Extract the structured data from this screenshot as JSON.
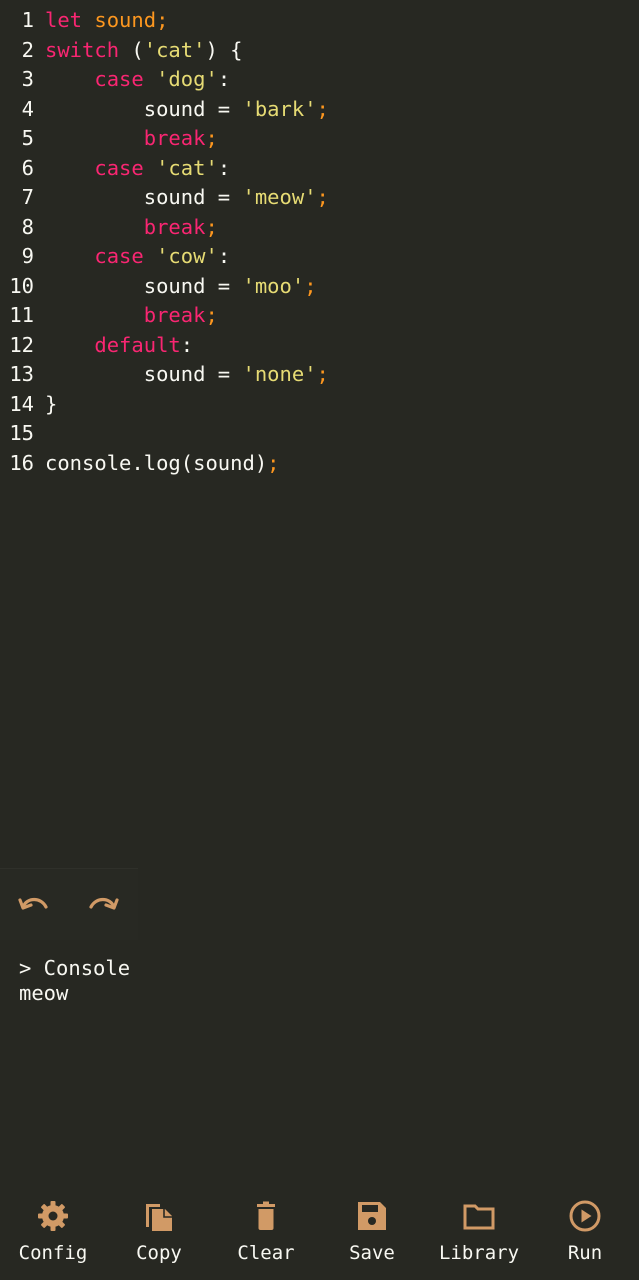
{
  "colors": {
    "background": "#272822",
    "keyword": "#f92672",
    "variable": "#fd971f",
    "string": "#e6db74",
    "text": "#f8f8f2",
    "icon": "#d19a66"
  },
  "editor": {
    "lines": [
      {
        "n": "1",
        "tokens": [
          {
            "t": "let",
            "c": "kw"
          },
          {
            "t": " sound",
            "c": "var"
          },
          {
            "t": ";",
            "c": "punc"
          }
        ]
      },
      {
        "n": "2",
        "tokens": [
          {
            "t": "switch",
            "c": "kw"
          },
          {
            "t": " (",
            "c": "plain"
          },
          {
            "t": "'cat'",
            "c": "str"
          },
          {
            "t": ") {",
            "c": "plain"
          }
        ]
      },
      {
        "n": "3",
        "tokens": [
          {
            "t": "    ",
            "c": "plain"
          },
          {
            "t": "case",
            "c": "kw"
          },
          {
            "t": " ",
            "c": "plain"
          },
          {
            "t": "'dog'",
            "c": "str"
          },
          {
            "t": ":",
            "c": "plain"
          }
        ]
      },
      {
        "n": "4",
        "tokens": [
          {
            "t": "        sound = ",
            "c": "plain"
          },
          {
            "t": "'bark'",
            "c": "str"
          },
          {
            "t": ";",
            "c": "punc"
          }
        ]
      },
      {
        "n": "5",
        "tokens": [
          {
            "t": "        ",
            "c": "plain"
          },
          {
            "t": "break",
            "c": "kw"
          },
          {
            "t": ";",
            "c": "punc"
          }
        ]
      },
      {
        "n": "6",
        "tokens": [
          {
            "t": "    ",
            "c": "plain"
          },
          {
            "t": "case",
            "c": "kw"
          },
          {
            "t": " ",
            "c": "plain"
          },
          {
            "t": "'cat'",
            "c": "str"
          },
          {
            "t": ":",
            "c": "plain"
          }
        ]
      },
      {
        "n": "7",
        "tokens": [
          {
            "t": "        sound = ",
            "c": "plain"
          },
          {
            "t": "'meow'",
            "c": "str"
          },
          {
            "t": ";",
            "c": "punc"
          }
        ]
      },
      {
        "n": "8",
        "tokens": [
          {
            "t": "        ",
            "c": "plain"
          },
          {
            "t": "break",
            "c": "kw"
          },
          {
            "t": ";",
            "c": "punc"
          }
        ]
      },
      {
        "n": "9",
        "tokens": [
          {
            "t": "    ",
            "c": "plain"
          },
          {
            "t": "case",
            "c": "kw"
          },
          {
            "t": " ",
            "c": "plain"
          },
          {
            "t": "'cow'",
            "c": "str"
          },
          {
            "t": ":",
            "c": "plain"
          }
        ]
      },
      {
        "n": "10",
        "tokens": [
          {
            "t": "        sound = ",
            "c": "plain"
          },
          {
            "t": "'moo'",
            "c": "str"
          },
          {
            "t": ";",
            "c": "punc"
          }
        ]
      },
      {
        "n": "11",
        "tokens": [
          {
            "t": "        ",
            "c": "plain"
          },
          {
            "t": "break",
            "c": "kw"
          },
          {
            "t": ";",
            "c": "punc"
          }
        ]
      },
      {
        "n": "12",
        "tokens": [
          {
            "t": "    ",
            "c": "plain"
          },
          {
            "t": "default",
            "c": "kw"
          },
          {
            "t": ":",
            "c": "plain"
          }
        ]
      },
      {
        "n": "13",
        "tokens": [
          {
            "t": "        sound = ",
            "c": "plain"
          },
          {
            "t": "'none'",
            "c": "str"
          },
          {
            "t": ";",
            "c": "punc"
          }
        ]
      },
      {
        "n": "14",
        "tokens": [
          {
            "t": "}",
            "c": "plain"
          }
        ]
      },
      {
        "n": "15",
        "tokens": []
      },
      {
        "n": "16",
        "tokens": [
          {
            "t": "console.log(sound)",
            "c": "plain"
          },
          {
            "t": ";",
            "c": "punc"
          }
        ]
      }
    ]
  },
  "history": {
    "undo_icon": "undo-icon",
    "redo_icon": "redo-icon"
  },
  "console": {
    "header": "> Console",
    "output": "meow"
  },
  "toolbar": {
    "config_label": "Config",
    "copy_label": "Copy",
    "clear_label": "Clear",
    "save_label": "Save",
    "library_label": "Library",
    "run_label": "Run"
  }
}
